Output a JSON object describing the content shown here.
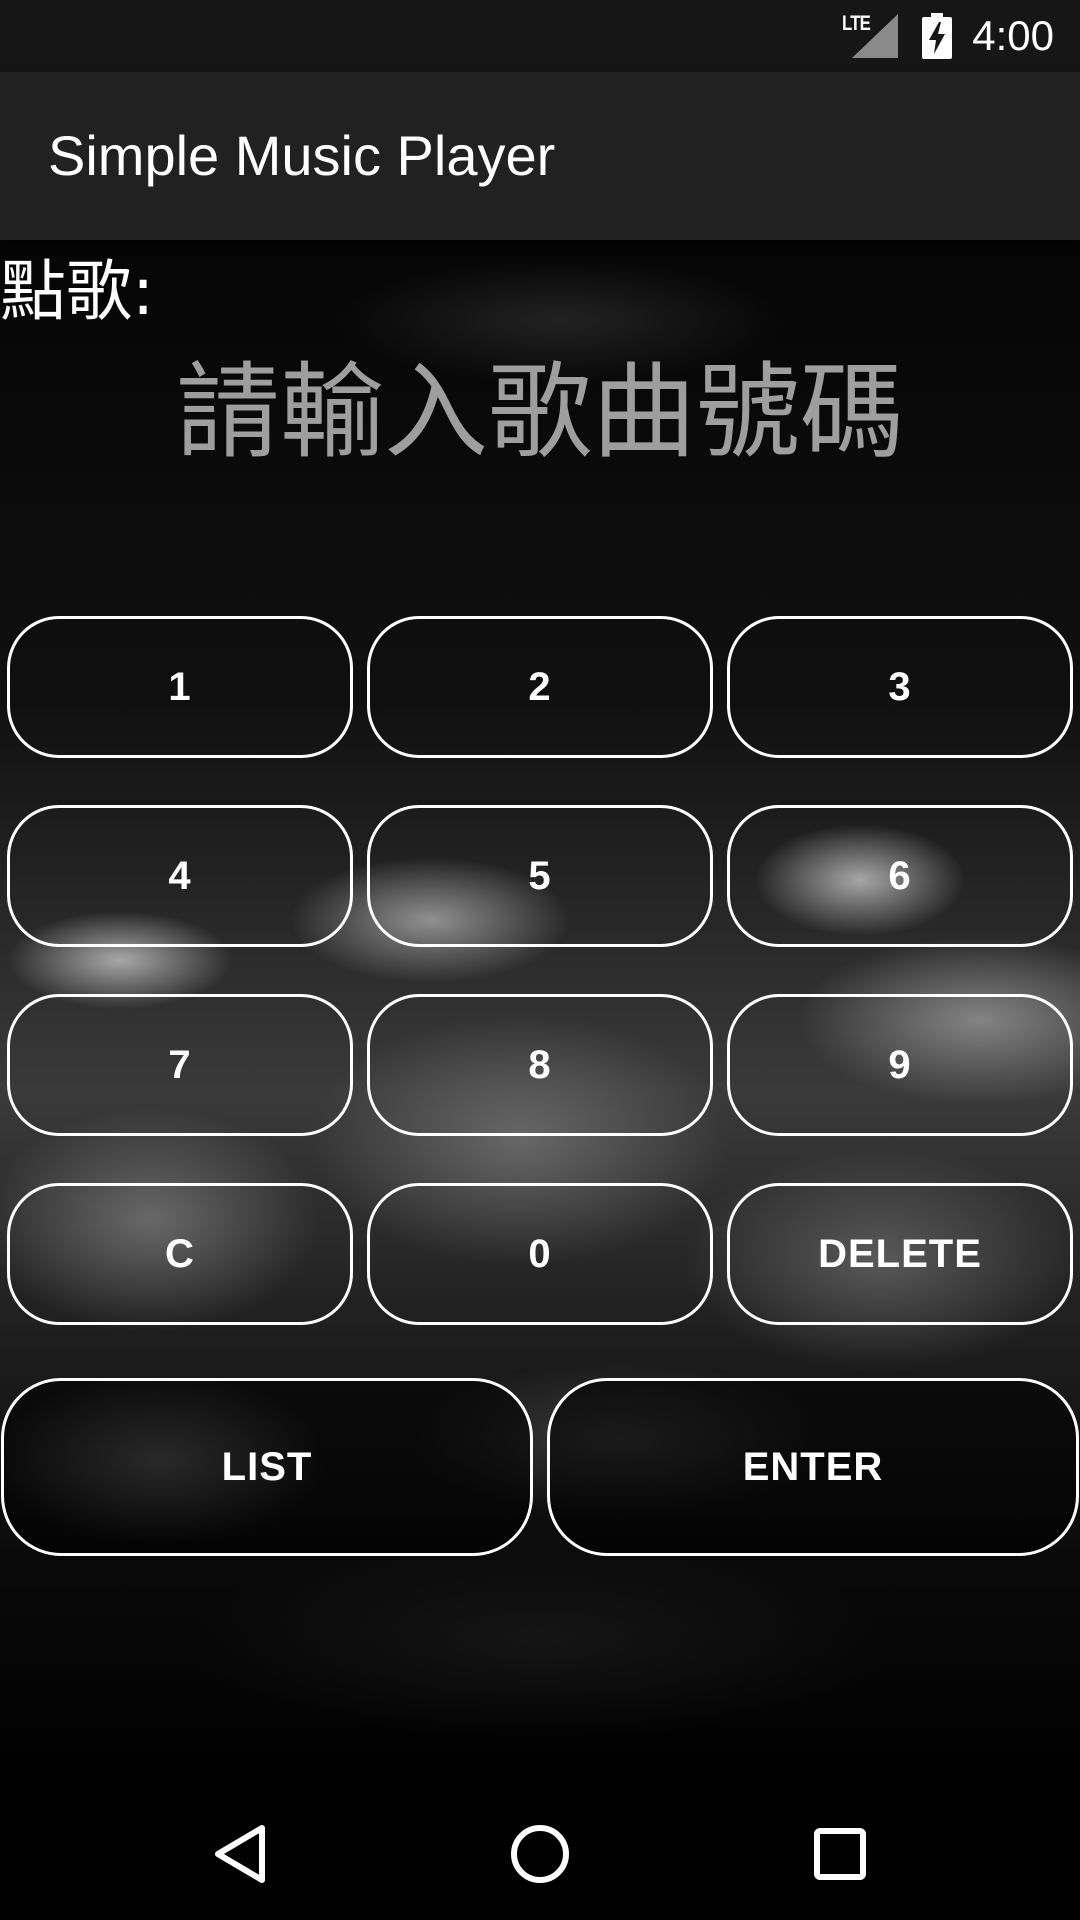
{
  "status_bar": {
    "network_label": "LTE",
    "time": "4:00"
  },
  "app_bar": {
    "title": "Simple Music Player"
  },
  "content": {
    "request_label": "點歌:",
    "song_number_placeholder": "請輸入歌曲號碼"
  },
  "keypad": {
    "keys": [
      "1",
      "2",
      "3",
      "4",
      "5",
      "6",
      "7",
      "8",
      "9",
      "C",
      "0",
      "DELETE"
    ],
    "list_label": "LIST",
    "enter_label": "ENTER"
  },
  "icons": {
    "signal": "signal-icon",
    "battery": "battery-charging-icon",
    "back": "back-icon",
    "home": "home-icon",
    "recents": "recents-icon"
  }
}
